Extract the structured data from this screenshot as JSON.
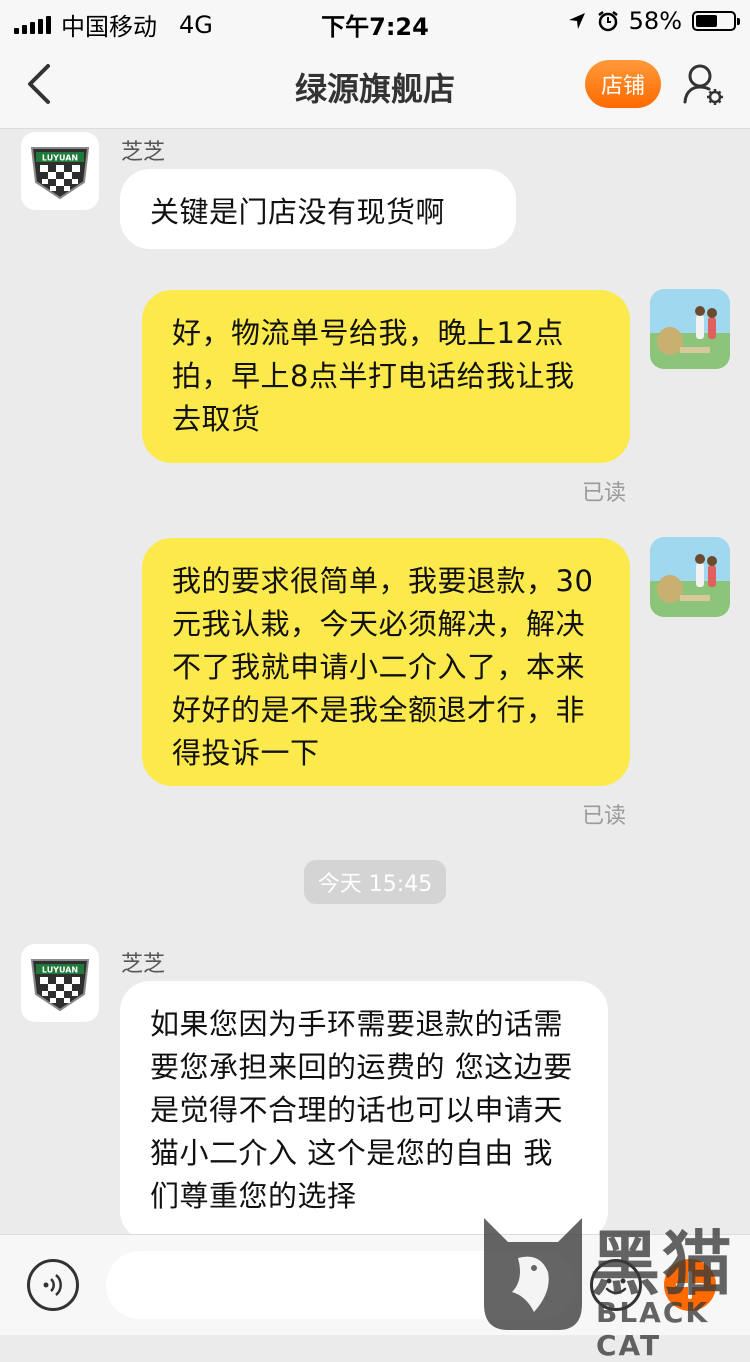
{
  "status_bar": {
    "carrier": "中国移动",
    "network": "4G",
    "time": "下午7:24",
    "battery": "58%",
    "battery_level": 0.58
  },
  "nav": {
    "title": "绿源旗舰店",
    "shop_button": "店铺"
  },
  "messages": [
    {
      "sender": "芝芝",
      "text": "关键是门店没有现货啊"
    },
    {
      "text": "好，物流单号给我，晚上12点拍，早上8点半打电话给我让我去取货",
      "status": "已读"
    },
    {
      "text": "我的要求很简单，我要退款，30元我认栽，今天必须解决，解决不了我就申请小二介入了，本来好好的是不是我全额退才行，非得投诉一下",
      "status": "已读"
    },
    {
      "sender": "芝芝",
      "text": "如果您因为手环需要退款的话需要您承担来回的运费的 您这边要是觉得不合理的话也可以申请天猫小二介入 这个是您的自由 我们尊重您的选择"
    }
  ],
  "time_divider": "今天 15:45",
  "avatar_logo_text": "LUYUAN",
  "watermark": {
    "cn": "黑猫",
    "en": "BLACK CAT"
  },
  "colors": {
    "accent": "#ff6a00",
    "outgoing_bubble": "#fcea4c",
    "incoming_bubble": "#ffffff",
    "background": "#ebebeb"
  },
  "icons": {
    "back": "chevron-left-icon",
    "user_settings": "user-gear-icon",
    "voice": "voice-icon",
    "emoji": "emoji-icon",
    "plus": "plus-icon"
  }
}
